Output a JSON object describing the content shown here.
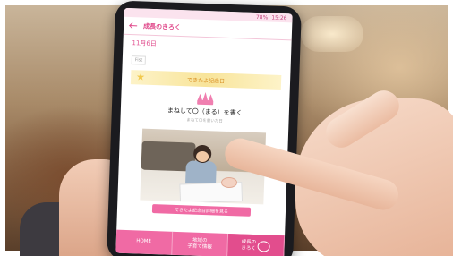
{
  "app": {
    "title": "成長のきろく",
    "status_time": "15:26",
    "status_battery": "78%"
  },
  "entry": {
    "date": "11月6日",
    "tag": "Fist",
    "ribbon_label": "できたよ記念日",
    "milestone_title": "まねして〇（まる）を書く",
    "milestone_sub": "まねて〇を書いた日"
  },
  "more_link_label": "できたよ記念日詳細を見る",
  "bottom_nav": {
    "home": "HOME",
    "info": "地域の\n子育て情報",
    "record": "成長の\nきろく"
  },
  "icons": [
    "back-arrow-icon",
    "star-icon",
    "crown-icon",
    "book-icon"
  ],
  "colors": {
    "accent": "#f06aa4",
    "ribbon": "#f8e49a"
  }
}
